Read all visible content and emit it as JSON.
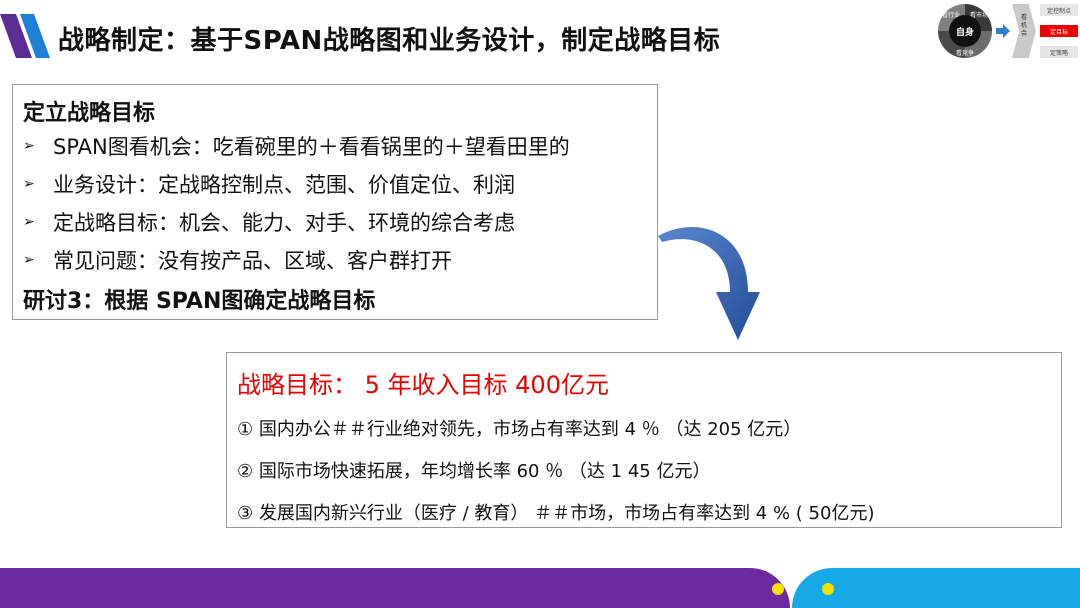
{
  "slide": {
    "title": "战略制定：基于SPAN战略图和业务设计，制定战略目标"
  },
  "mini_diagram": {
    "core": "自身",
    "ring_labels": [
      "看行业",
      "看市场",
      "看竞争"
    ],
    "chevron_text": "看机会",
    "steps": [
      "定控制点",
      "定目标",
      "定策略"
    ],
    "active_step_index": 1
  },
  "left_box": {
    "heading": "定立战略目标",
    "bullets": [
      "SPAN图看机会：吃看碗里的＋看看锅里的＋望看田里的",
      "业务设计：定战略控制点、范围、价值定位、利润",
      "定战略目标：机会、能力、对手、环境的综合考虑",
      "常见问题：没有按产品、区域、客户群打开"
    ],
    "discussion": "研讨3：根据 SPAN图确定战略目标"
  },
  "goal_box": {
    "title": "战略目标：  5 年收入目标 400亿元",
    "items": [
      "① 国内办公＃＃行业绝对领先，市场占有率达到 4 ％ （达 205 亿元）",
      "② 国际市场快速拓展，年均增长率 60 ％ （达 1 45 亿元）",
      "③ 发展国内新兴行业（医疗 / 教育） ＃＃市场，市场占有率达到 4 % ( 50亿元)"
    ]
  },
  "colors": {
    "accent_red": "#e00000",
    "footer_purple": "#6b2aa0",
    "footer_cyan": "#17a8e6",
    "dot_yellow": "#f5e000",
    "logo_blue": "#1d7fd6",
    "logo_purple": "#5b2c91",
    "arrow_blue": "#2f5fb3"
  },
  "icons": {
    "logo": "slash-stripes-logo-icon",
    "curve_arrow": "curved-down-arrow-icon"
  }
}
